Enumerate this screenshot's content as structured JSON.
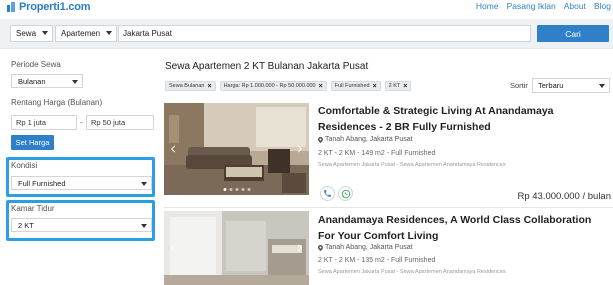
{
  "header": {
    "logo_text": "Properti1.com",
    "nav": [
      "Home",
      "Pasang Iklan",
      "About",
      "Blog"
    ],
    "colors": {
      "brand": "#2b7ec8",
      "accent": "#2f80c8",
      "highlight": "#2a9fe3"
    }
  },
  "search": {
    "listing_type": "Sewa",
    "property_type": "Apartemen",
    "location_value": "Jakarta Pusat",
    "button_label": "Cari"
  },
  "filters": {
    "period": {
      "label": "Periode Sewa",
      "value": "Bulanan"
    },
    "price": {
      "label": "Rentang Harga (Bulanan)",
      "min_value": "Rp 1 juta",
      "separator": "-",
      "max_value": "Rp 50 juta",
      "button_label": "Set Harga"
    },
    "condition": {
      "label": "Kondisi",
      "value": "Full Furnished"
    },
    "bedrooms": {
      "label": "Kamar Tidur",
      "value": "2 KT"
    }
  },
  "results": {
    "title": "Sewa Apartemen 2 KT Bulanan Jakarta Pusat",
    "chips": [
      "Sewa Bulanan",
      "Harga: Rp 1.000.000 - Rp 50.000.000",
      "Full Furnished",
      "2 KT"
    ],
    "sort": {
      "label": "Sortir",
      "value": "Terbaru"
    },
    "listings": [
      {
        "title": "Comfortable & Strategic Living At Anandamaya Residences - 2 BR Fully Furnished",
        "location": "Tanah Abang, Jakarta Pusat",
        "specs": "2 KT - 2 KM - 149 m2 - Full Furnished",
        "crumb": "Sewa Apartemen Jakarta Pusat - Sewa Apartemen Anandamaya Residences",
        "price": "Rp 43.000.000",
        "price_unit": "/ bulan"
      },
      {
        "title": "Anandamaya Residences, A World Class Collaboration For Your Comfort Living",
        "location": "Tanah Abang, Jakarta Pusat",
        "specs": "2 KT - 2 KM - 135 m2 - Full Furnished",
        "crumb": "Sewa Apartemen Jakarta Pusat - Sewa Apartemen Anandamaya Residences"
      }
    ]
  }
}
